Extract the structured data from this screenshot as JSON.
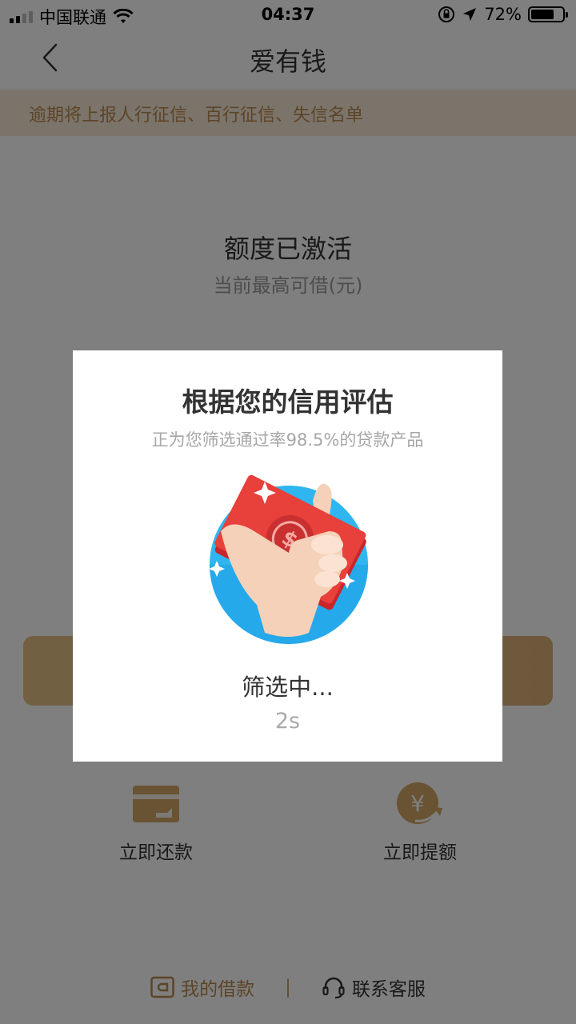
{
  "status_bar": {
    "carrier": "中国联通",
    "time": "04:37",
    "battery_percent": "72%",
    "battery_level": 0.72
  },
  "nav": {
    "title": "爱有钱",
    "back_icon": "chevron-left-icon"
  },
  "banner": {
    "text": "逾期将上报人行征信、百行征信、失信名单"
  },
  "quota": {
    "title": "额度已激活",
    "subtitle": "当前最高可借(元)"
  },
  "actions": [
    {
      "label": "立即还款",
      "icon": "wallet-icon"
    },
    {
      "label": "立即提额",
      "icon": "yuan-arrow-icon"
    }
  ],
  "bottom_links": {
    "my_loans": "我的借款",
    "separator": "|",
    "customer_service": "联系客服"
  },
  "modal": {
    "title": "根据您的信用评估",
    "subtitle": "正为您筛选通过率98.5%的贷款产品",
    "status": "筛选中...",
    "countdown": "2s",
    "illustration": "hand-holding-money-icon"
  },
  "colors": {
    "accent_gold": "#b8884f",
    "button_gold": "#e0b77c",
    "banner_bg": "#f7e9d7",
    "modal_circle_blue": "#2fb6f0",
    "money_red": "#e8403a"
  }
}
